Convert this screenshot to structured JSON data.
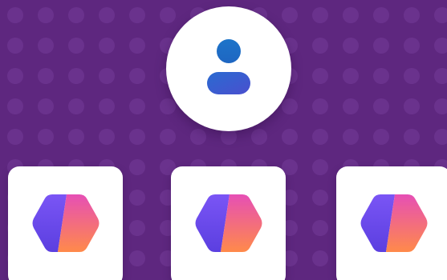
{
  "background": {
    "color": "#5e277f",
    "dot_color": "#6d3590"
  },
  "profile": {
    "icon": "person-icon",
    "icon_color_top": "#1b73c8",
    "icon_color_bottom": "#4a4fcf"
  },
  "tiles": [
    {
      "icon": "hexagon-app-icon"
    },
    {
      "icon": "hexagon-app-icon"
    },
    {
      "icon": "hexagon-app-icon"
    }
  ],
  "hexagon_gradient": {
    "left_top": "#7a55f5",
    "left_bottom": "#5b3fe0",
    "right_top": "#e64fb5",
    "right_bottom": "#ff8a4a"
  }
}
